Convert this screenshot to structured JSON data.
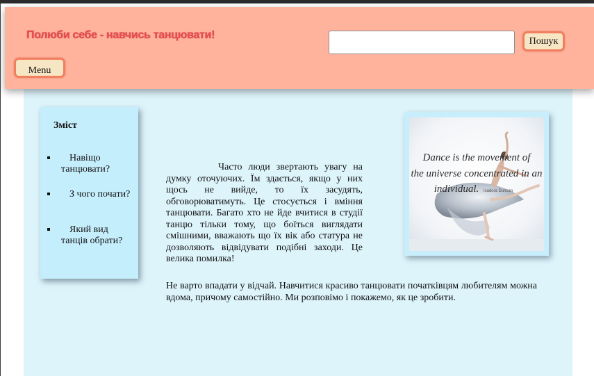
{
  "header": {
    "title": "Полюби себе - навчись танцювати!",
    "search": {
      "value": "",
      "placeholder": ""
    },
    "search_button": "Пошук",
    "menu_button": "Menu"
  },
  "toc": {
    "title": "Зміст",
    "items": [
      {
        "label": "Навіщо танцювати?"
      },
      {
        "label": "З чого почати?"
      },
      {
        "label": "Який вид танців обрати?"
      }
    ]
  },
  "article": {
    "paragraph1": "Часто люди звертають увагу на думку оточуючих. Їм здається, якщо у них щось не вийде, то їх засудять, обговорюватимуть. Це стосується і вміння танцювати. Багато хто не йде вчитися в студії танцю тільки тому, що боїться виглядати смішними, вважають що їх вік або статура не дозволяють відвідувати подібні заходи. Це велика помилка!",
    "paragraph2": "Не варто впадати у відчай. Навчитися красиво танцювати початківцям любителям можна вдома, причому самостійно. Ми розповімо і покажемо, як це зробити."
  },
  "image": {
    "quote_line1": "Dance is the movement of",
    "quote_line2": "the universe concentrated in an",
    "quote_line3": "individual.",
    "quote_author": "Isadora Duncan"
  },
  "colors": {
    "header_bg": "#ffb29c",
    "title_color": "#e84c4c",
    "content_bg": "#ddf4fb",
    "panel_bg": "#c5eefc",
    "button_bg": "#f7e6c4",
    "button_border": "#f08060"
  }
}
